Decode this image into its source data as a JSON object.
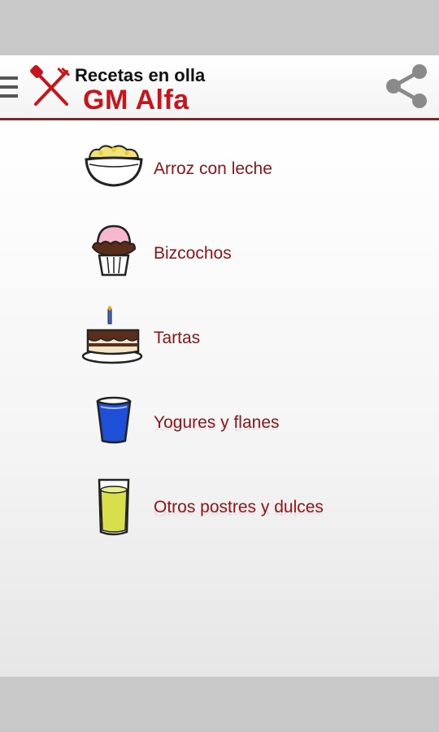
{
  "app_bar": {
    "title_line1": "Recetas en olla",
    "title_line2": "GM Alfa",
    "menu_icon": "hamburger-menu-icon",
    "logo_icon": "crossed-fork-spatula-icon",
    "share_icon": "share-icon"
  },
  "categories": [
    {
      "label": "Arroz con leche",
      "icon": "rice-pudding-bowl-icon"
    },
    {
      "label": "Bizcochos",
      "icon": "cupcake-icon"
    },
    {
      "label": "Tartas",
      "icon": "birthday-cake-icon"
    },
    {
      "label": "Yogures y flanes",
      "icon": "yogurt-cup-icon"
    },
    {
      "label": "Otros postres y dulces",
      "icon": "dessert-glass-icon"
    }
  ],
  "colors": {
    "accent": "#8e1418",
    "logo_red": "#c7161b",
    "system_bars": "#c8c8c8"
  }
}
